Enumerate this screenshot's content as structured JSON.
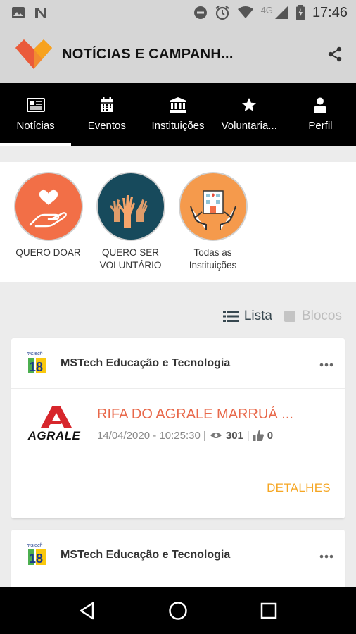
{
  "status_bar": {
    "time": "17:46",
    "network": "4G",
    "icons": [
      "image-icon",
      "n-icon",
      "do-not-disturb-icon",
      "alarm-icon",
      "wifi-icon",
      "signal-icon",
      "battery-icon"
    ]
  },
  "app_bar": {
    "title": "NOTÍCIAS E CAMPANH...",
    "share_icon": "share-icon"
  },
  "tabs": [
    {
      "label": "Notícias",
      "icon": "newspaper-icon",
      "active": true
    },
    {
      "label": "Eventos",
      "icon": "calendar-icon",
      "active": false
    },
    {
      "label": "Instituições",
      "icon": "institution-icon",
      "active": false
    },
    {
      "label": "Voluntaria...",
      "icon": "star-icon",
      "active": false
    },
    {
      "label": "Perfil",
      "icon": "person-icon",
      "active": false
    }
  ],
  "quick_actions": [
    {
      "label": "QUERO DOAR",
      "color": "#f26f47"
    },
    {
      "label": "QUERO SER VOLUNTÁRIO",
      "color": "#174a5c"
    },
    {
      "label": "Todas as Instituições",
      "color": "#f59a4c"
    }
  ],
  "view_toggle": {
    "list_label": "Lista",
    "blocks_label": "Blocos"
  },
  "news": [
    {
      "org": "MSTech Educação e Tecnologia",
      "title": "RIFA DO AGRALE MARRUÁ ...",
      "brand": "AGRALE",
      "date": "14/04/2020 - 10:25:30 |",
      "views": "301",
      "likes": "0",
      "details_label": "DETALHES"
    },
    {
      "org": "MSTech Educação e Tecnologia"
    }
  ],
  "colors": {
    "accent_orange": "#e8684a",
    "details_yellow": "#f5a623",
    "tab_bar": "#000000",
    "app_bar": "#d6d6d6"
  }
}
